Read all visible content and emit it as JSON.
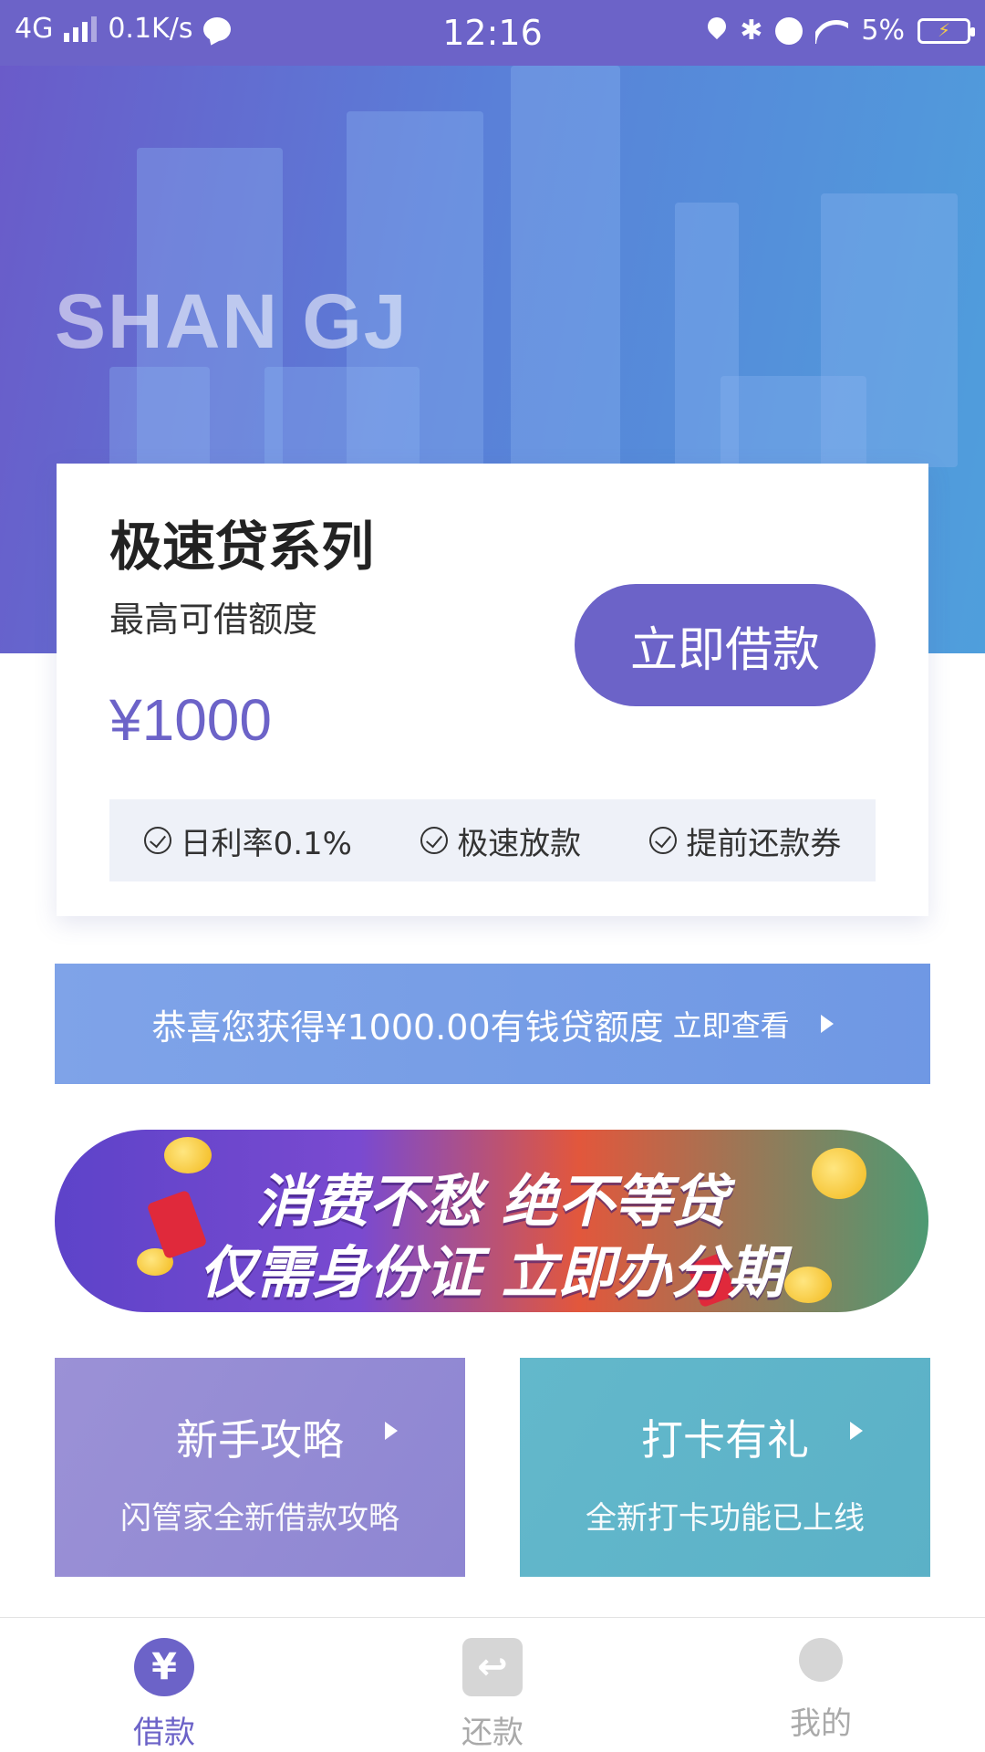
{
  "status_bar": {
    "network": "4G",
    "speed": "0.1K/s",
    "time": "12:16",
    "battery": "5%"
  },
  "hero": {
    "logo_text": "SHAN GJ"
  },
  "loan_card": {
    "title": "极速贷系列",
    "subtitle": "最高可借额度",
    "amount": "¥1000",
    "button_label": "立即借款",
    "features": [
      "日利率0.1%",
      "极速放款",
      "提前还款券"
    ]
  },
  "notice": {
    "text": "恭喜您获得¥1000.00有钱贷额度",
    "link": "立即查看"
  },
  "promo": {
    "line1": "消费不愁 绝不等贷",
    "line2": "仅需身份证 立即办分期"
  },
  "tiles": [
    {
      "title": "新手攻略",
      "subtitle": "闪管家全新借款攻略"
    },
    {
      "title": "打卡有礼",
      "subtitle": "全新打卡功能已上线"
    }
  ],
  "bottom_nav": [
    {
      "label": "借款",
      "icon": "yen-icon",
      "active": true
    },
    {
      "label": "还款",
      "icon": "repay-icon",
      "active": false
    },
    {
      "label": "我的",
      "icon": "profile-icon",
      "active": false
    }
  ],
  "colors": {
    "accent": "#6c63c8",
    "notice": "#7aa0e6",
    "tile_purple": "#9a90d6",
    "tile_teal": "#61b6ca"
  }
}
